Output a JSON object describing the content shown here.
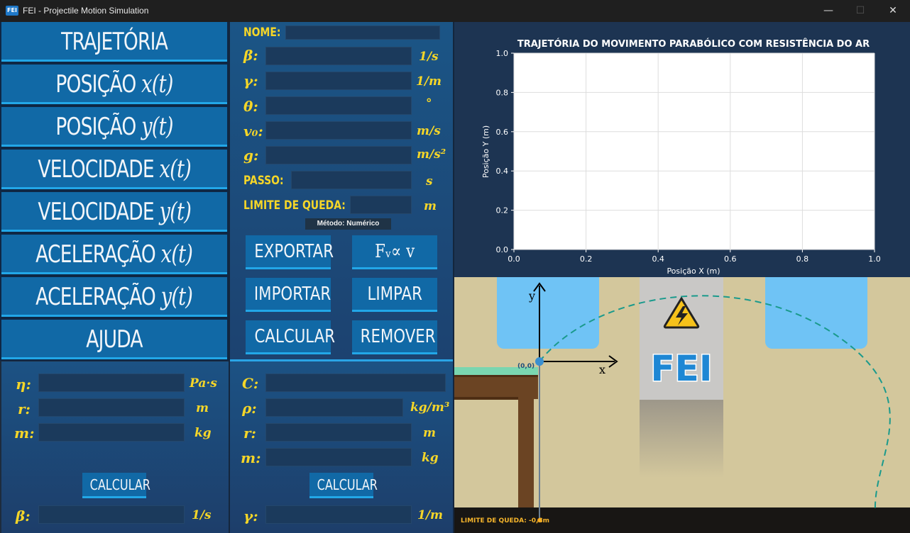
{
  "window": {
    "logo_text": "FEI",
    "title": "FEI - Projectile Motion Simulation",
    "minimize": "—",
    "maximize": "☐",
    "close": "✕"
  },
  "nav": [
    {
      "label": "TRAJETÓRIA",
      "math": ""
    },
    {
      "label": "POSIÇÃO ",
      "math": "x(t)"
    },
    {
      "label": "POSIÇÃO ",
      "math": "y(t)"
    },
    {
      "label": "VELOCIDADE ",
      "math": "x(t)"
    },
    {
      "label": "VELOCIDADE ",
      "math": "y(t)"
    },
    {
      "label": "ACELERAÇÃO ",
      "math": "x(t)"
    },
    {
      "label": "ACELERAÇÃO ",
      "math": "y(t)"
    },
    {
      "label": "AJUDA",
      "math": ""
    }
  ],
  "params": {
    "nome_label": "NOME:",
    "beta_label": "β:",
    "beta_unit": "1/s",
    "gamma_label": "γ:",
    "gamma_unit": "1/m",
    "theta_label": "θ:",
    "theta_unit": "°",
    "v0_label": "v₀:",
    "v0_unit": "m/s",
    "g_label": "g:",
    "g_unit": "m/s²",
    "passo_label": "PASSO:",
    "passo_unit": "s",
    "limite_label": "LIMITE DE QUEDA:",
    "limite_unit": "m",
    "method": "Método: Numérico"
  },
  "actions": {
    "exportar": "EXPORTAR",
    "force": "Fᵥ∝ v",
    "importar": "IMPORTAR",
    "limpar": "LIMPAR",
    "calcular": "CALCULAR",
    "remover": "REMOVER"
  },
  "stokes": {
    "eta_label": "η:",
    "eta_unit": "Pa·s",
    "r_label": "r:",
    "r_unit": "m",
    "m_label": "m:",
    "m_unit": "kg",
    "calc": "CALCULAR",
    "beta_label": "β:",
    "beta_unit": "1/s"
  },
  "drag": {
    "c_label": "C:",
    "rho_label": "ρ:",
    "rho_unit": "kg/m³",
    "r_label": "r:",
    "r_unit": "m",
    "m_label": "m:",
    "m_unit": "kg",
    "calc": "CALCULAR",
    "gamma_label": "γ:",
    "gamma_unit": "1/m"
  },
  "chart_data": {
    "type": "line",
    "title": "TRAJETÓRIA DO MOVIMENTO PARABÓLICO COM RESISTÊNCIA DO AR",
    "xlabel": "Posição X (m)",
    "ylabel": "Posição Y (m)",
    "xlim": [
      0.0,
      1.0
    ],
    "ylim": [
      0.0,
      1.0
    ],
    "xticks": [
      "0.0",
      "0.2",
      "0.4",
      "0.6",
      "0.8",
      "1.0"
    ],
    "yticks": [
      "0.0",
      "0.2",
      "0.4",
      "0.6",
      "0.8",
      "1.0"
    ],
    "grid": true,
    "series": []
  },
  "scene": {
    "y_axis": "y",
    "x_axis": "x",
    "origin": "(0,0)",
    "logo": "FEI",
    "limit_text": "LIMITE DE QUEDA: -0,8m"
  },
  "colors": {
    "accent": "#22a7e8",
    "button": "#1169a6",
    "label_yellow": "#f5d628",
    "trajectory": "#1a9a8c"
  }
}
